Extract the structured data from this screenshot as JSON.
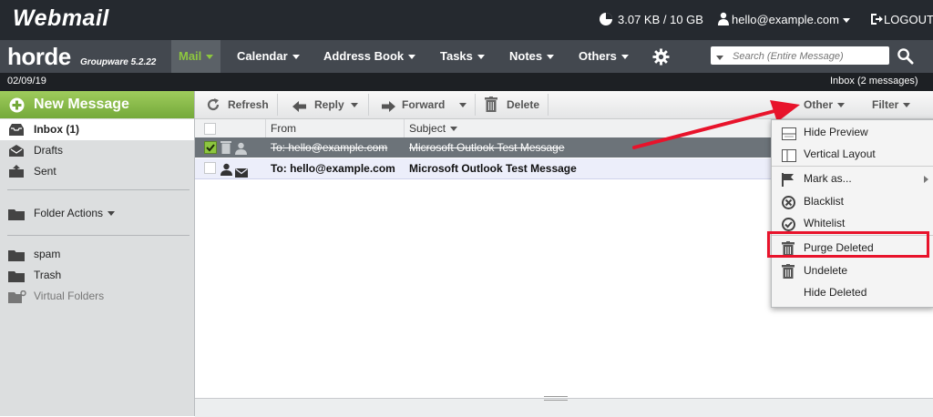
{
  "header": {
    "logo": "Webmail",
    "quota": "3.07 KB / 10 GB",
    "user": "hello@example.com",
    "logout": "LOGOUT"
  },
  "nav": {
    "brand": "horde",
    "version": "Groupware 5.2.22",
    "tabs": [
      {
        "label": "Mail",
        "active": true
      },
      {
        "label": "Calendar"
      },
      {
        "label": "Address Book"
      },
      {
        "label": "Tasks"
      },
      {
        "label": "Notes"
      },
      {
        "label": "Others"
      }
    ],
    "search_placeholder": "Search (Entire Message)"
  },
  "statusbar": {
    "date": "02/09/19",
    "inbox_status": "Inbox (2 messages)"
  },
  "sidebar": {
    "new_message": "New Message",
    "folders": [
      {
        "label": "Inbox (1)",
        "icon": "inbox-icon"
      },
      {
        "label": "Drafts",
        "icon": "drafts-icon"
      },
      {
        "label": "Sent",
        "icon": "sent-icon"
      }
    ],
    "folder_actions": "Folder Actions",
    "other_folders": [
      {
        "label": "spam",
        "icon": "folder-icon"
      },
      {
        "label": "Trash",
        "icon": "folder-icon"
      },
      {
        "label": "Virtual Folders",
        "icon": "virtual-folder-icon"
      }
    ]
  },
  "toolbar": {
    "refresh": "Refresh",
    "reply": "Reply",
    "forward": "Forward",
    "delete": "Delete",
    "other": "Other",
    "filter": "Filter"
  },
  "list": {
    "col_from": "From",
    "col_subject": "Subject",
    "rows": [
      {
        "from": "To: hello@example.com",
        "subject": "Microsoft Outlook Test Message",
        "deleted": true,
        "selected": true
      },
      {
        "from": "To: hello@example.com",
        "subject": "Microsoft Outlook Test Message",
        "deleted": false,
        "unread": true
      }
    ]
  },
  "other_menu": {
    "items": [
      {
        "label": "Hide Preview",
        "icon": "hide-preview-icon"
      },
      {
        "label": "Vertical Layout",
        "icon": "layout-icon"
      },
      {
        "label": "Mark as...",
        "icon": "flag-icon",
        "submenu": true
      },
      {
        "label": "Blacklist",
        "icon": "blacklist-icon"
      },
      {
        "label": "Whitelist",
        "icon": "whitelist-icon"
      },
      {
        "label": "Purge Deleted",
        "icon": "trash-icon",
        "highlighted": true
      },
      {
        "label": "Undelete",
        "icon": "trash-icon"
      },
      {
        "label": "Hide Deleted",
        "icon": ""
      }
    ]
  },
  "colors": {
    "accent_green": "#8dc63f",
    "annotation_red": "#e8132b",
    "topbar": "#25292f"
  }
}
